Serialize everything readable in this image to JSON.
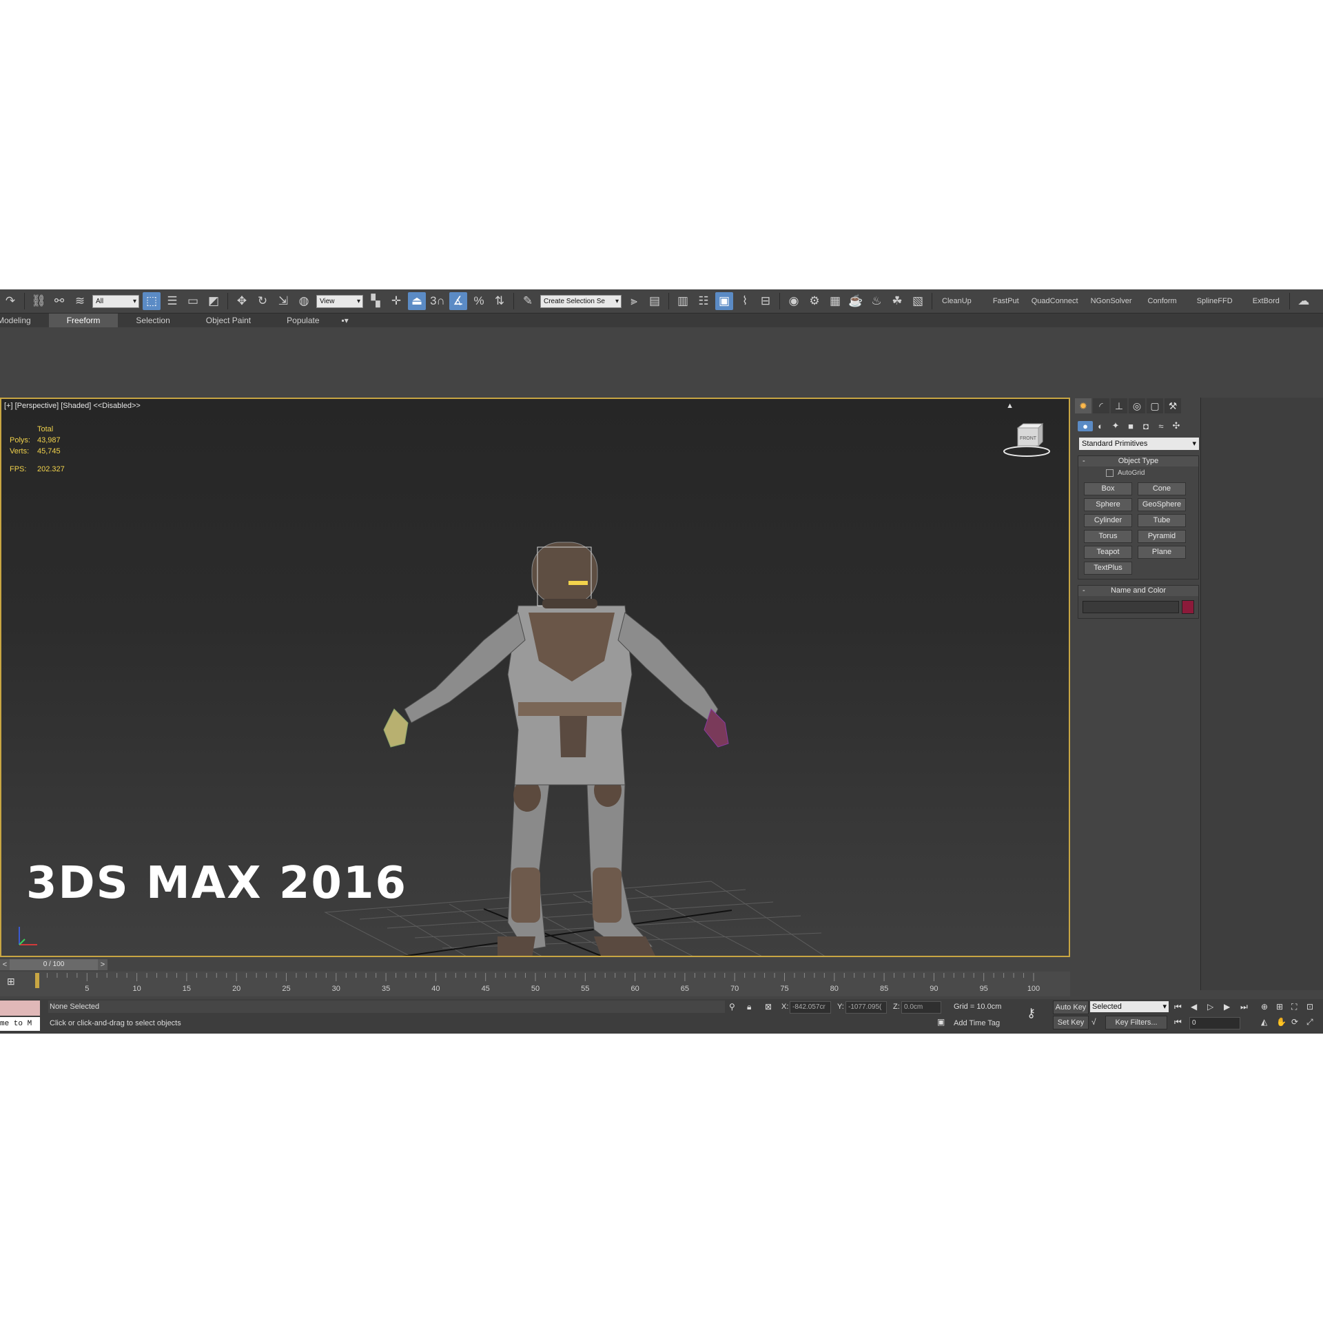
{
  "toolbar": {
    "selection_filter": "All",
    "coord_system": "View",
    "named_selection_placeholder": "Create Selection Se",
    "snap_label": "3",
    "angle_snap_label": "%",
    "plugins": [
      "CleanUp",
      "FastPut",
      "QuadConnect",
      "NGonSolver",
      "Conform",
      "SplineFFD",
      "ExtBord"
    ]
  },
  "ribbon": {
    "tabs": [
      "Modeling",
      "Freeform",
      "Selection",
      "Object Paint",
      "Populate"
    ],
    "active_tab": "Freeform"
  },
  "viewport": {
    "label": "[+] [Perspective] [Shaded]  <<Disabled>>",
    "stats": {
      "header": "Total",
      "polys_label": "Polys:",
      "polys": "43,987",
      "verts_label": "Verts:",
      "verts": "45,745",
      "fps_label": "FPS:",
      "fps": "202.327"
    },
    "watermark": "3DS MAX 2016",
    "viewcube_label": "FRONT"
  },
  "command_panel": {
    "category": "Standard Primitives",
    "object_type_title": "Object Type",
    "autogrid_label": "AutoGrid",
    "primitives": [
      "Box",
      "Cone",
      "Sphere",
      "GeoSphere",
      "Cylinder",
      "Tube",
      "Torus",
      "Pyramid",
      "Teapot",
      "Plane",
      "TextPlus"
    ],
    "name_color_title": "Name and Color",
    "object_color": "#8c1a3a"
  },
  "timeline": {
    "frame_display": "0 / 100",
    "ticks": [
      "5",
      "10",
      "15",
      "20",
      "25",
      "30",
      "35",
      "40",
      "45",
      "50",
      "55",
      "60",
      "65",
      "70",
      "75",
      "80",
      "85",
      "90",
      "95",
      "100"
    ]
  },
  "status": {
    "maxscript_text": "me to M",
    "selection": "None Selected",
    "prompt": "Click or click-and-drag to select objects",
    "x_label": "X:",
    "x_value": "-842.057cr",
    "y_label": "Y:",
    "y_value": "-1077.095(",
    "z_label": "Z:",
    "z_value": "0.0cm",
    "grid": "Grid = 10.0cm",
    "add_time_tag": "Add Time Tag",
    "auto_key": "Auto Key",
    "set_key": "Set Key",
    "key_mode": "Selected",
    "key_filters": "Key Filters...",
    "current_frame": "0"
  },
  "colors": {
    "viewport_border": "#c8a643",
    "stats_text": "#f2d34c",
    "active_tool": "#5b8bc5"
  }
}
